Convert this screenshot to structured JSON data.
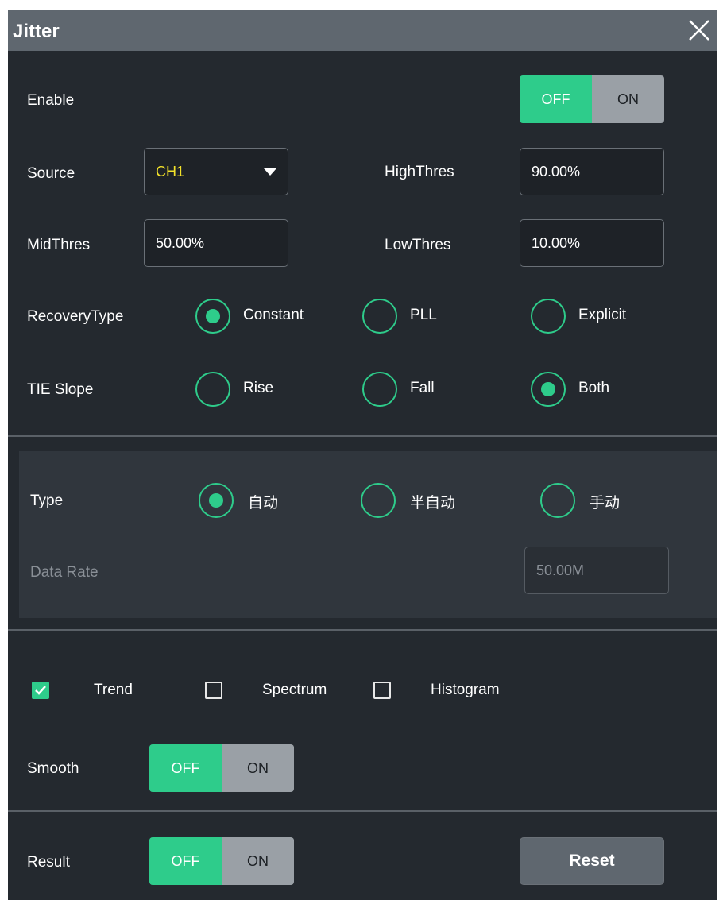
{
  "title": "Jitter",
  "enable": {
    "label": "Enable",
    "off": "OFF",
    "on": "ON",
    "state": "OFF"
  },
  "source": {
    "label": "Source",
    "value": "CH1"
  },
  "high_thres": {
    "label": "HighThres",
    "value": "90.00%"
  },
  "mid_thres": {
    "label": "MidThres",
    "value": "50.00%"
  },
  "low_thres": {
    "label": "LowThres",
    "value": "10.00%"
  },
  "recovery_type": {
    "label": "RecoveryType",
    "options": [
      "Constant",
      "PLL",
      "Explicit"
    ],
    "selected": "Constant"
  },
  "tie_slope": {
    "label": "TIE Slope",
    "options": [
      "Rise",
      "Fall",
      "Both"
    ],
    "selected": "Both"
  },
  "type": {
    "label": "Type",
    "options": [
      "自动",
      "半自动",
      "手动"
    ],
    "selected": "自动"
  },
  "data_rate": {
    "label": "Data Rate",
    "value": "50.00M"
  },
  "views": {
    "trend": "Trend",
    "spectrum": "Spectrum",
    "histogram": "Histogram",
    "trend_checked": true,
    "spectrum_checked": false,
    "histogram_checked": false
  },
  "smooth": {
    "label": "Smooth",
    "off": "OFF",
    "on": "ON",
    "state": "OFF"
  },
  "result": {
    "label": "Result",
    "off": "OFF",
    "on": "ON",
    "state": "OFF"
  },
  "reset_label": "Reset",
  "colors": {
    "accent": "#2ecc8b",
    "panel": "#24292f",
    "titlebar": "#5f676f",
    "source_text": "#f2e12a"
  }
}
